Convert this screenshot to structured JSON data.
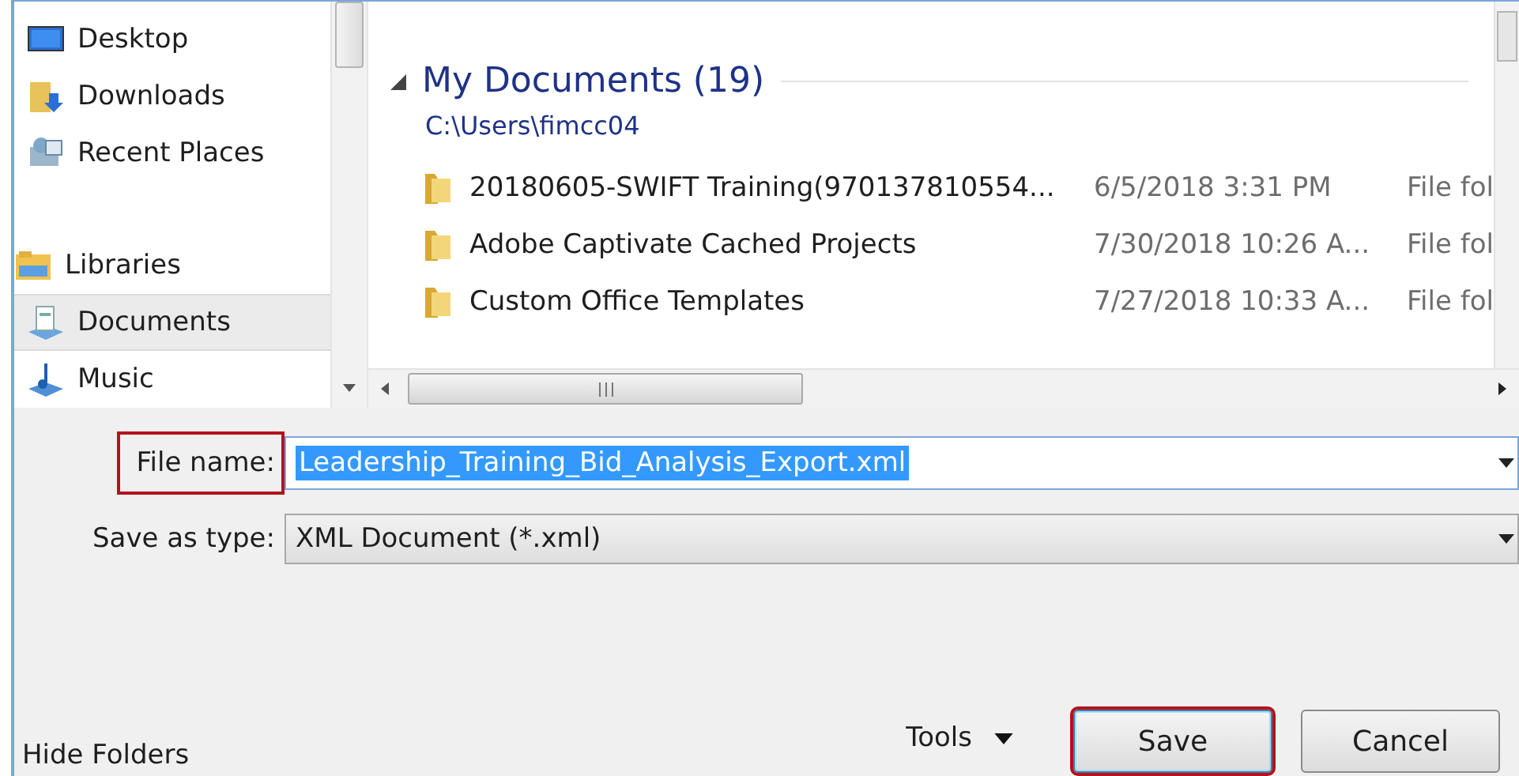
{
  "nav_pane": {
    "favorites": [
      {
        "label": "Desktop",
        "kind": "desktop",
        "selected": false
      },
      {
        "label": "Downloads",
        "kind": "downloads",
        "selected": false
      },
      {
        "label": "Recent Places",
        "kind": "recent",
        "selected": false
      }
    ],
    "libraries": {
      "label": "Libraries",
      "kind": "libraries",
      "selected": false,
      "children": [
        {
          "label": "Documents",
          "kind": "documents",
          "selected": true
        },
        {
          "label": "Music",
          "kind": "music",
          "selected": false
        }
      ]
    }
  },
  "file_list": {
    "group": {
      "title": "My Documents (19)",
      "path": "C:\\Users\\fimcc04",
      "expanded": true
    },
    "rows": [
      {
        "name": "20180605-SWIFT Training(970137810554...",
        "date": "6/5/2018 3:31 PM",
        "type": "File fol"
      },
      {
        "name": "Adobe Captivate Cached Projects",
        "date": "7/30/2018 10:26 A...",
        "type": "File fol"
      },
      {
        "name": "Custom Office Templates",
        "date": "7/27/2018 10:33 A...",
        "type": "File fol"
      }
    ]
  },
  "form": {
    "file_name": {
      "label": "File name:",
      "value": "Leadership_Training_Bid_Analysis_Export.xml",
      "text_selected": true,
      "highlighted": true
    },
    "save_as_type": {
      "label": "Save as type:",
      "value": "XML Document (*.xml)",
      "highlighted": false
    }
  },
  "hide_folders": "Hide Folders",
  "tools": "Tools",
  "buttons": [
    {
      "label": "Save",
      "kind": "primary",
      "highlighted": true
    },
    {
      "label": "Cancel",
      "kind": "normal",
      "highlighted": false
    }
  ]
}
